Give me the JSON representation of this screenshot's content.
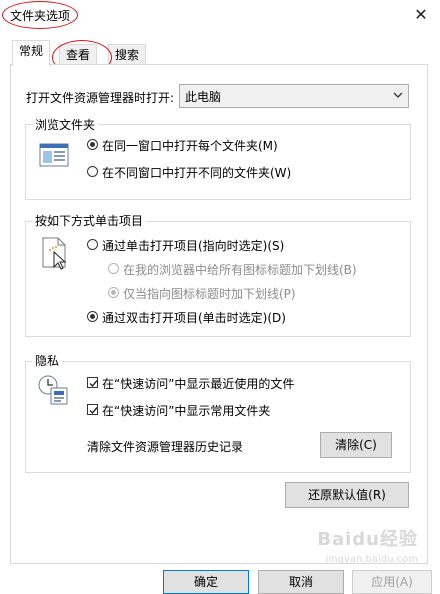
{
  "window": {
    "title": "文件夹选项",
    "close_glyph": "✕"
  },
  "tabs": [
    {
      "label": "常规",
      "active": true
    },
    {
      "label": "查看",
      "active": false
    },
    {
      "label": "搜索",
      "active": false
    }
  ],
  "general": {
    "open_in_label": "打开文件资源管理器时打开:",
    "open_in_value": "此电脑",
    "browse_group": {
      "title": "浏览文件夹",
      "options": [
        {
          "label": "在同一窗口中打开每个文件夹(M)",
          "checked": true
        },
        {
          "label": "在不同窗口中打开不同的文件夹(W)",
          "checked": false
        }
      ]
    },
    "click_group": {
      "title": "按如下方式单击项目",
      "single_click": {
        "label": "通过单击打开项目(指向时选定)(S)",
        "checked": false
      },
      "underline_always": {
        "label": "在我的浏览器中给所有图标标题加下划线(B)",
        "checked": false,
        "disabled": true
      },
      "underline_hover": {
        "label": "仅当指向图标标题时加下划线(P)",
        "checked": true,
        "disabled": true
      },
      "double_click": {
        "label": "通过双击打开项目(单击时选定)(D)",
        "checked": true
      }
    },
    "privacy_group": {
      "title": "隐私",
      "recent_files": {
        "label": "在“快速访问”中显示最近使用的文件",
        "checked": true
      },
      "frequent_folders": {
        "label": "在“快速访问”中显示常用文件夹",
        "checked": true
      },
      "clear_history_label": "清除文件资源管理器历史记录",
      "clear_button": "清除(C)"
    },
    "restore_defaults": "还原默认值(R)"
  },
  "footer": {
    "ok": "确定",
    "cancel": "取消",
    "apply": "应用(A)"
  },
  "watermark": {
    "main": "Baidu经验",
    "sub": "jingyan.baidu.com"
  },
  "colors": {
    "annotation": "#d8141e",
    "border": "#adadad",
    "button_bg": "#e1e1e1"
  }
}
